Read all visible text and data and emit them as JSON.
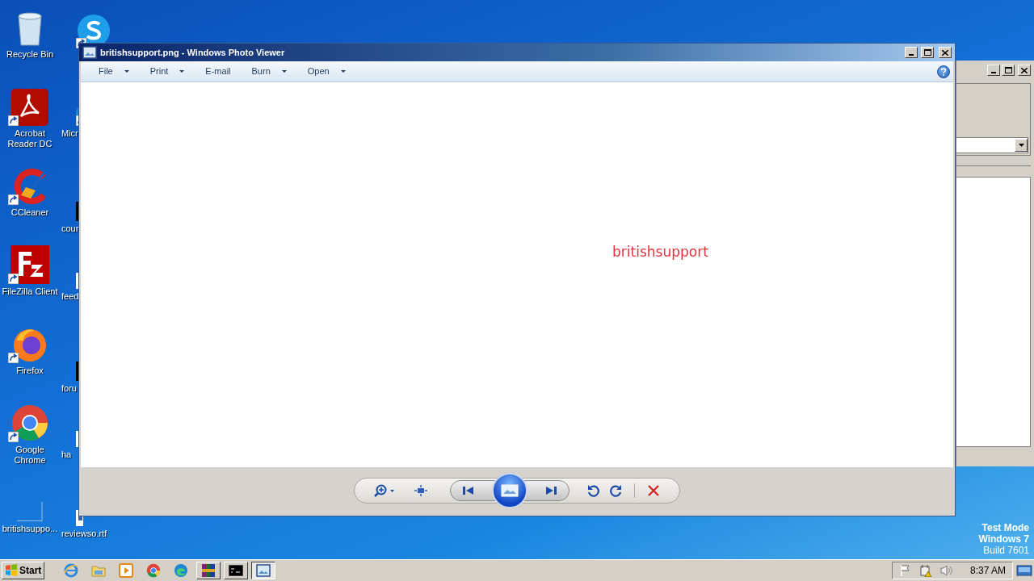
{
  "desktop": {
    "icons": [
      {
        "label": "Recycle Bin",
        "kind": "recycle",
        "shortcut": false
      },
      {
        "label": "Acrobat Reader DC",
        "kind": "pdf",
        "shortcut": true
      },
      {
        "label": "CCleaner",
        "kind": "ccleaner",
        "shortcut": true
      },
      {
        "label": "FileZilla Client",
        "kind": "filezilla",
        "shortcut": true
      },
      {
        "label": "Firefox",
        "kind": "firefox",
        "shortcut": true
      },
      {
        "label": "Google Chrome",
        "kind": "chrome",
        "shortcut": true
      },
      {
        "label": "britishsuppo...",
        "kind": "blank",
        "shortcut": false
      },
      {
        "kind": "skype",
        "shortcut": true
      },
      {
        "label": "Micr",
        "kind": "edge",
        "shortcut": true
      },
      {
        "label": "cour",
        "kind": "black",
        "shortcut": false
      },
      {
        "label": "feed",
        "kind": "document",
        "shortcut": false
      },
      {
        "label": "foru",
        "kind": "black",
        "shortcut": false
      },
      {
        "label": "ha",
        "kind": "document",
        "shortcut": false
      },
      {
        "label": "reviewso.rtf",
        "kind": "document",
        "shortcut": false
      }
    ],
    "watermark_lines": [
      "Test Mode",
      "Windows 7",
      "Build 7601"
    ]
  },
  "photo_viewer": {
    "title": "britishsupport.png - Windows Photo Viewer",
    "menu": [
      {
        "label": "File",
        "dropdown": true
      },
      {
        "label": "Print",
        "dropdown": true
      },
      {
        "label": "E-mail",
        "dropdown": false
      },
      {
        "label": "Burn",
        "dropdown": true
      },
      {
        "label": "Open",
        "dropdown": true
      }
    ],
    "image_text": "britishsupport"
  },
  "taskbar": {
    "start": "Start",
    "items": [
      {
        "kind": "ie",
        "active": false
      },
      {
        "kind": "folder",
        "active": false
      },
      {
        "kind": "media",
        "active": false
      },
      {
        "kind": "chrome",
        "active": false
      },
      {
        "kind": "edge",
        "active": false
      },
      {
        "kind": "winrar",
        "active": false
      },
      {
        "kind": "cmd",
        "active": false
      },
      {
        "kind": "photo",
        "active": true
      }
    ],
    "clock": "8:37 AM"
  }
}
